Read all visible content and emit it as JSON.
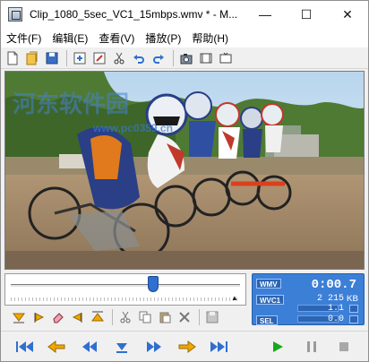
{
  "window": {
    "title": "Clip_1080_5sec_VC1_15mbps.wmv * - M...",
    "minimize": "—",
    "maximize": "☐",
    "close": "✕"
  },
  "menu": {
    "items": [
      {
        "label": "文件(F)"
      },
      {
        "label": "编辑(E)"
      },
      {
        "label": "查看(V)"
      },
      {
        "label": "播放(P)"
      },
      {
        "label": "帮助(H)"
      }
    ]
  },
  "watermark": {
    "text": "河东软件园",
    "url": "www.pc0359.cn"
  },
  "seek": {
    "position": 0.62,
    "arrow": "▲"
  },
  "info": {
    "format_tag": "WMV",
    "time": "0:00.7",
    "codec_tag": "WVC1",
    "bitrate": "2 215",
    "bitrate_unit": "KB",
    "value2": "1.1",
    "sel_tag": "SEL",
    "sel_value": "0.0"
  },
  "colors": {
    "accent": "#3c7fd6",
    "play_green": "#17a81c",
    "nav_blue": "#2f6fcf",
    "mark_orange": "#f0a800"
  }
}
